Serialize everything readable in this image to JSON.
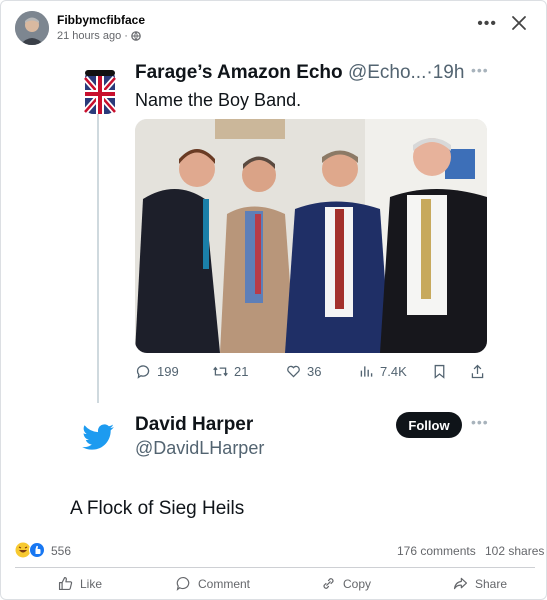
{
  "post": {
    "author": "Fibbymcfibface",
    "time": "21 hours ago",
    "separator": "·"
  },
  "tweet1": {
    "name": "Farage’s Amazon Echo",
    "handle": "@Echo...",
    "age": "·19h",
    "text": "Name the Boy Band.",
    "stats": {
      "replies": "199",
      "retweets": "21",
      "likes": "36",
      "views": "7.4K"
    }
  },
  "tweet2": {
    "name": "David Harper",
    "handle": "@DavidLHarper",
    "follow_label": "Follow",
    "text": "A Flock of Sieg Heils"
  },
  "footer": {
    "reaction_count": "556",
    "comments": "176 comments",
    "shares": "102 shares"
  },
  "actions": {
    "like": "Like",
    "comment": "Comment",
    "copy": "Copy",
    "share": "Share"
  },
  "colors": {
    "twitter_blue": "#1d9bf0",
    "fb_blue": "#1877f2",
    "text_dark": "#0f1419",
    "muted": "#536471"
  }
}
